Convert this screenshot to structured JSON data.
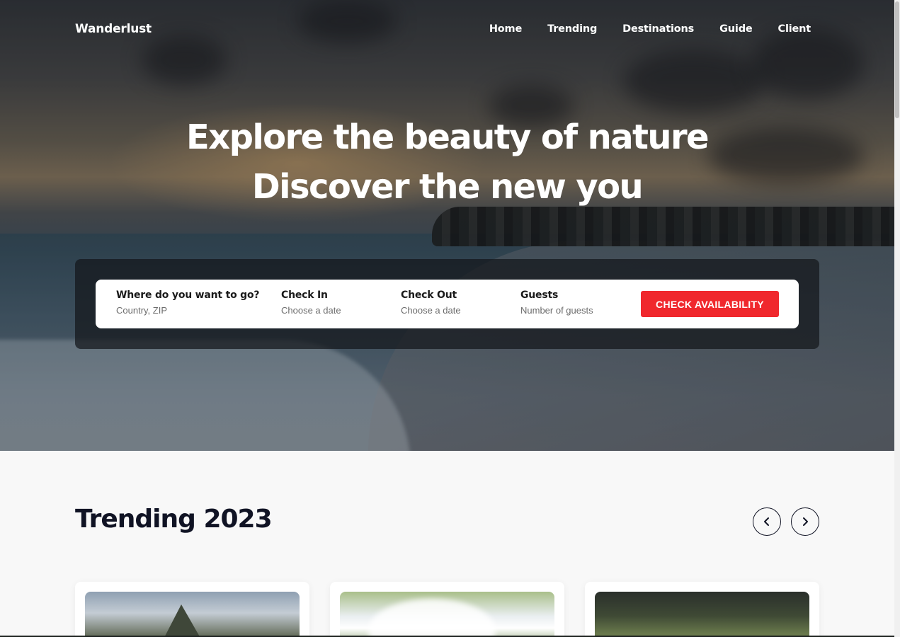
{
  "brand": "Wanderlust",
  "nav": [
    "Home",
    "Trending",
    "Destinations",
    "Guide",
    "Client"
  ],
  "hero": {
    "line1": "Explore the beauty of nature",
    "line2": "Discover the new you"
  },
  "search": {
    "fields": [
      {
        "label": "Where do you want to go?",
        "placeholder": "Country, ZIP"
      },
      {
        "label": "Check In",
        "placeholder": "Choose a date"
      },
      {
        "label": "Check Out",
        "placeholder": "Choose a date"
      },
      {
        "label": "Guests",
        "placeholder": "Number of guests"
      }
    ],
    "button": "CHECK AVAILABILITY"
  },
  "trending": {
    "title": "Trending 2023"
  },
  "icons": {
    "prev": "chevron-left-icon",
    "next": "chevron-right-icon"
  },
  "colors": {
    "accent": "#f0282d",
    "heading": "#101324"
  }
}
